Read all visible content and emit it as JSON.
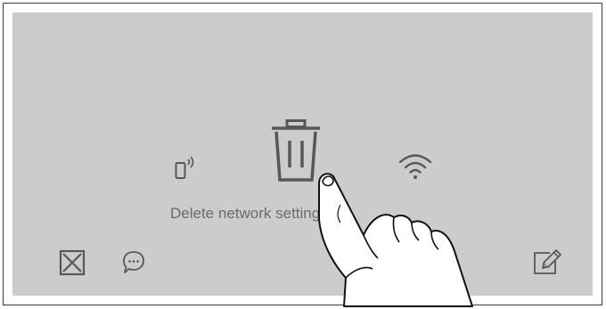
{
  "screen": {
    "status_text": "Delete network settings",
    "background_color": "#cccccc",
    "icon_color": "#575757"
  },
  "icons": {
    "phone": "smartphone-signal-icon",
    "trash": "trash-icon",
    "wifi": "wifi-icon",
    "close": "close-box-icon",
    "chat": "chat-bubble-icon",
    "edit": "edit-pencil-icon",
    "hand": "pointing-hand-icon"
  }
}
